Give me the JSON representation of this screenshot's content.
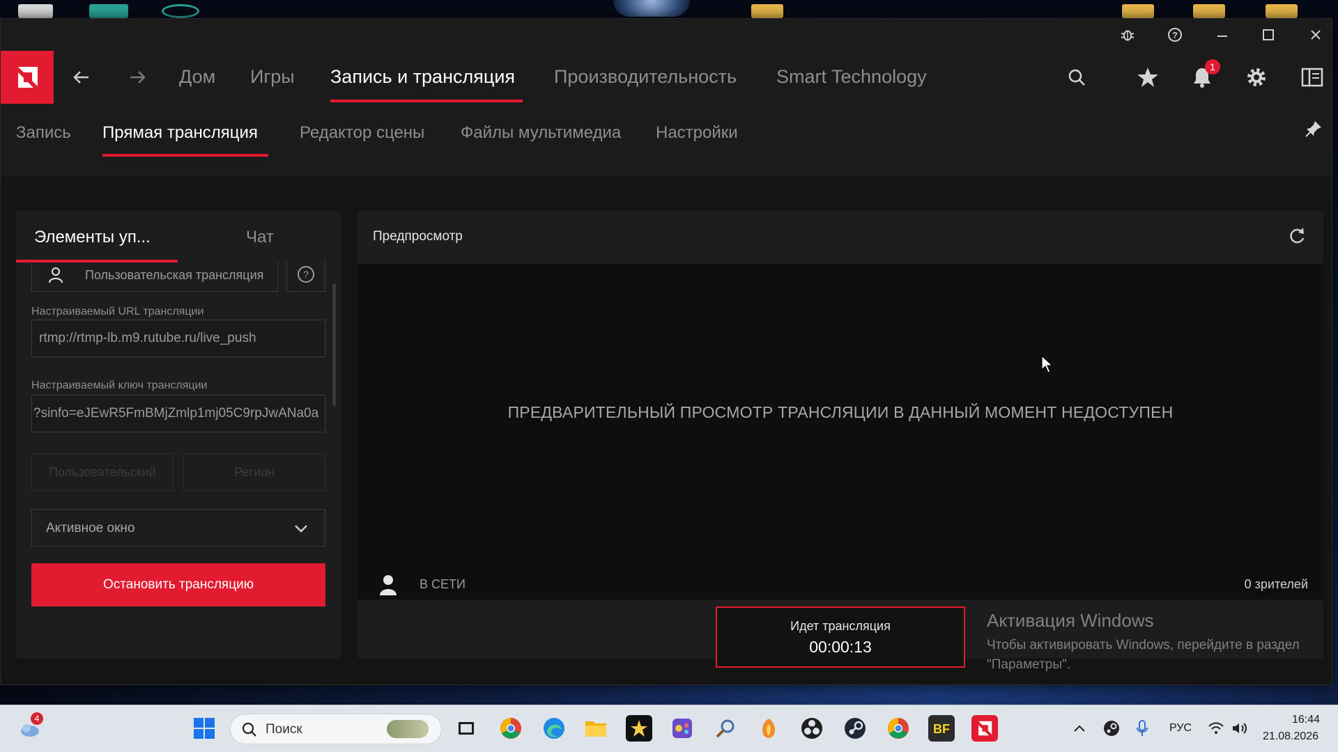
{
  "window": {
    "controls": [
      "bug-icon",
      "help-icon",
      "minimize-icon",
      "maximize-icon",
      "close-icon"
    ]
  },
  "nav": {
    "items": [
      "Дом",
      "Игры",
      "Запись и трансляция",
      "Производительность",
      "Smart Technology"
    ],
    "active_index": 2,
    "notification_count": "1"
  },
  "subnav": {
    "items": [
      "Запись",
      "Прямая трансляция",
      "Редактор сцены",
      "Файлы мультимедиа",
      "Настройки"
    ],
    "active_index": 1
  },
  "left_panel": {
    "tabs": [
      "Элементы уп...",
      "Чат"
    ],
    "service_label": "Пользовательская трансляция",
    "url_label": "Настраиваемый URL трансляции",
    "url_value": "rtmp://rtmp-lb.m9.rutube.ru/live_push",
    "key_label": "Настраиваемый ключ трансляции",
    "key_value": "?sinfo=eJEwR5FmBMjZmlp1mj05C9rpJwANa0a",
    "disabled_buttons": [
      "Пользовательский",
      "Регион"
    ],
    "capture_source": "Активное окно",
    "stop_button": "Остановить трансляцию"
  },
  "preview": {
    "title": "Предпросмотр",
    "message": "ПРЕДВАРИТЕЛЬНЫЙ ПРОСМОТР ТРАНСЛЯЦИИ В ДАННЫЙ МОМЕНТ НЕДОСТУПЕН",
    "status": "В СЕТИ",
    "viewers": "0 зрителей",
    "live_label": "Идет трансляция",
    "live_time": "00:00:13"
  },
  "activation": {
    "title": "Активация Windows",
    "text": "Чтобы активировать Windows, перейдите в раздел \"Параметры\"."
  },
  "taskbar": {
    "search_placeholder": "Поиск",
    "badge_count": "4",
    "language": "РУС",
    "time": "16:44",
    "date": "21.08.2026"
  },
  "colors": {
    "accent": "#e31b31",
    "background": "#141414",
    "panel": "#1d1d1d"
  }
}
